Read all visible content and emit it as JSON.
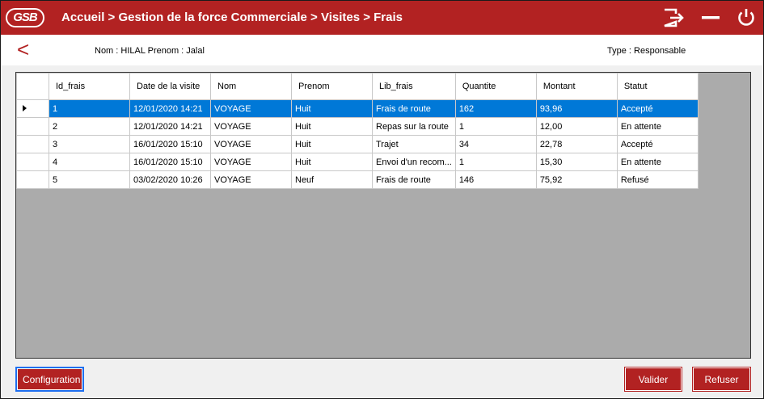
{
  "header": {
    "logo_text": "GSB",
    "breadcrumb": "Accueil > Gestion de la force Commerciale > Visites > Frais",
    "icons": [
      "logout-icon",
      "minimize-icon",
      "power-icon"
    ]
  },
  "info": {
    "back_symbol": "<",
    "name_text": "Nom : HILAL  Prenom : Jalal",
    "type_text": "Type : Responsable"
  },
  "table": {
    "columns": [
      "Id_frais",
      "Date de la visite",
      "Nom",
      "Prenom",
      "Lib_frais",
      "Quantite",
      "Montant",
      "Statut"
    ],
    "rows": [
      [
        "1",
        "12/01/2020 14:21",
        "VOYAGE",
        "Huit",
        "Frais de route",
        "162",
        "93,96",
        "Accepté"
      ],
      [
        "2",
        "12/01/2020 14:21",
        "VOYAGE",
        "Huit",
        "Repas sur la route",
        "1",
        "12,00",
        "En attente"
      ],
      [
        "3",
        "16/01/2020 15:10",
        "VOYAGE",
        "Huit",
        "Trajet",
        "34",
        "22,78",
        "Accepté"
      ],
      [
        "4",
        "16/01/2020 15:10",
        "VOYAGE",
        "Huit",
        "Envoi d'un recom...",
        "1",
        "15,30",
        "En attente"
      ],
      [
        "5",
        "03/02/2020 10:26",
        "VOYAGE",
        "Neuf",
        "Frais de route",
        "146",
        "75,92",
        "Refusé"
      ]
    ],
    "selected_row": 0
  },
  "buttons": {
    "configuration": "Configuration",
    "valider": "Valider",
    "refuser": "Refuser"
  },
  "colors": {
    "brand": "#b22222",
    "selection": "#0078d7",
    "grid_background": "#ababab"
  }
}
